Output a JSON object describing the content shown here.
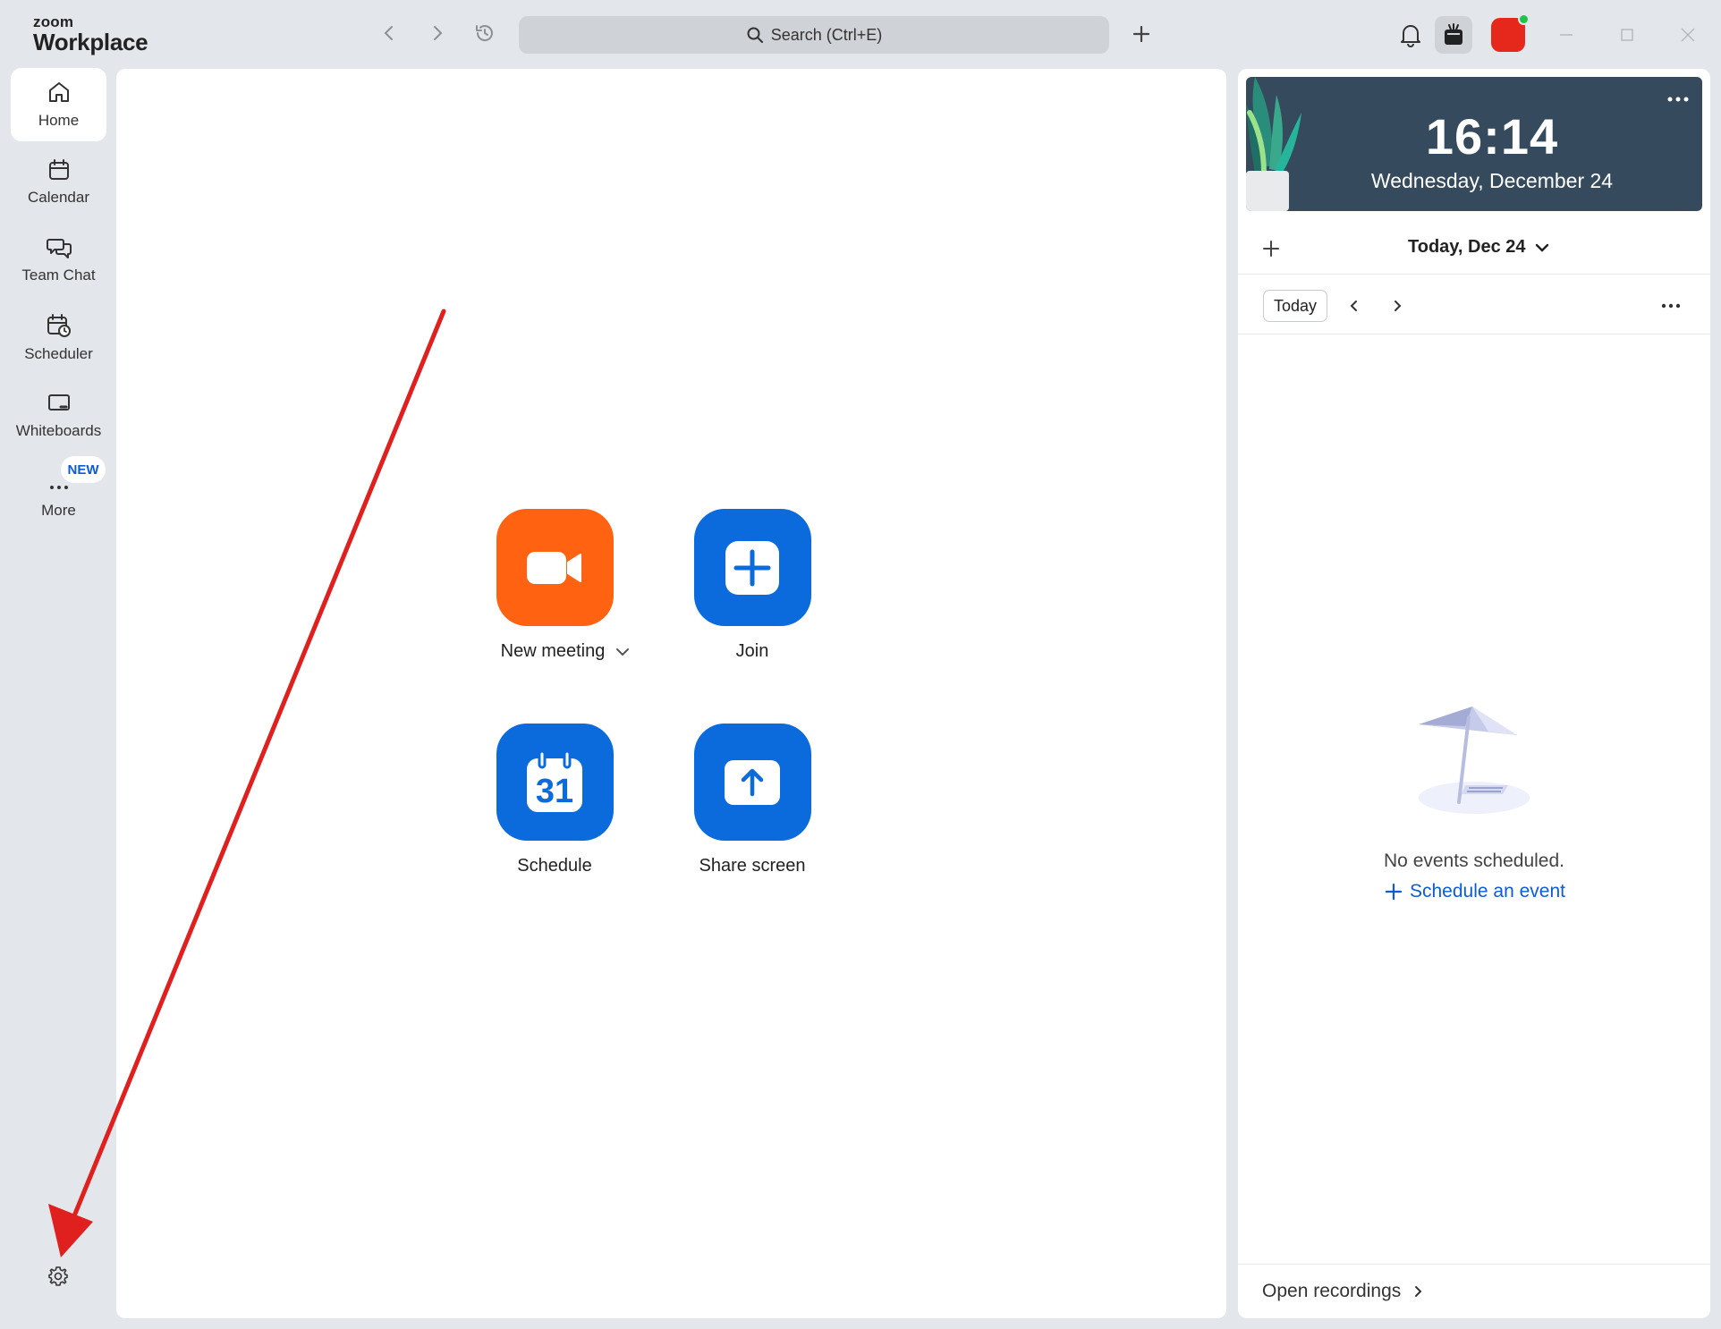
{
  "app": {
    "brand_small": "zoom",
    "brand_large": "Workplace"
  },
  "titlebar": {
    "search_label": "Search (Ctrl+E)"
  },
  "sidebar": {
    "items": [
      {
        "label": "Home",
        "icon": "home-icon",
        "active": true
      },
      {
        "label": "Calendar",
        "icon": "calendar-icon"
      },
      {
        "label": "Team Chat",
        "icon": "chat-icon"
      },
      {
        "label": "Scheduler",
        "icon": "scheduler-icon"
      },
      {
        "label": "Whiteboards",
        "icon": "whiteboard-icon"
      },
      {
        "label": "More",
        "icon": "more-icon"
      }
    ],
    "new_badge": "NEW",
    "settings_icon": "gear-icon"
  },
  "main": {
    "actions": [
      {
        "label": "New meeting",
        "icon": "video-camera-icon",
        "color": "#ff6312"
      },
      {
        "label": "Join",
        "icon": "plus-icon",
        "color": "#0b6bdd"
      },
      {
        "label": "Schedule",
        "icon": "calendar-31-icon",
        "calendar_day": "31",
        "color": "#0b6bdd"
      },
      {
        "label": "Share screen",
        "icon": "share-arrow-icon",
        "color": "#0b6bdd"
      }
    ]
  },
  "right_panel": {
    "clock": {
      "time": "16:14",
      "date": "Wednesday, December 24"
    },
    "calendar": {
      "title": "Today, Dec 24",
      "today_button": "Today",
      "empty_text": "No events scheduled.",
      "schedule_link": "Schedule an event"
    },
    "footer": {
      "recordings_link": "Open recordings"
    }
  },
  "colors": {
    "accent_blue": "#0b6bdd",
    "accent_orange": "#ff6312",
    "clock_card_bg": "#364a5d",
    "annotation_red": "#e0201f"
  }
}
